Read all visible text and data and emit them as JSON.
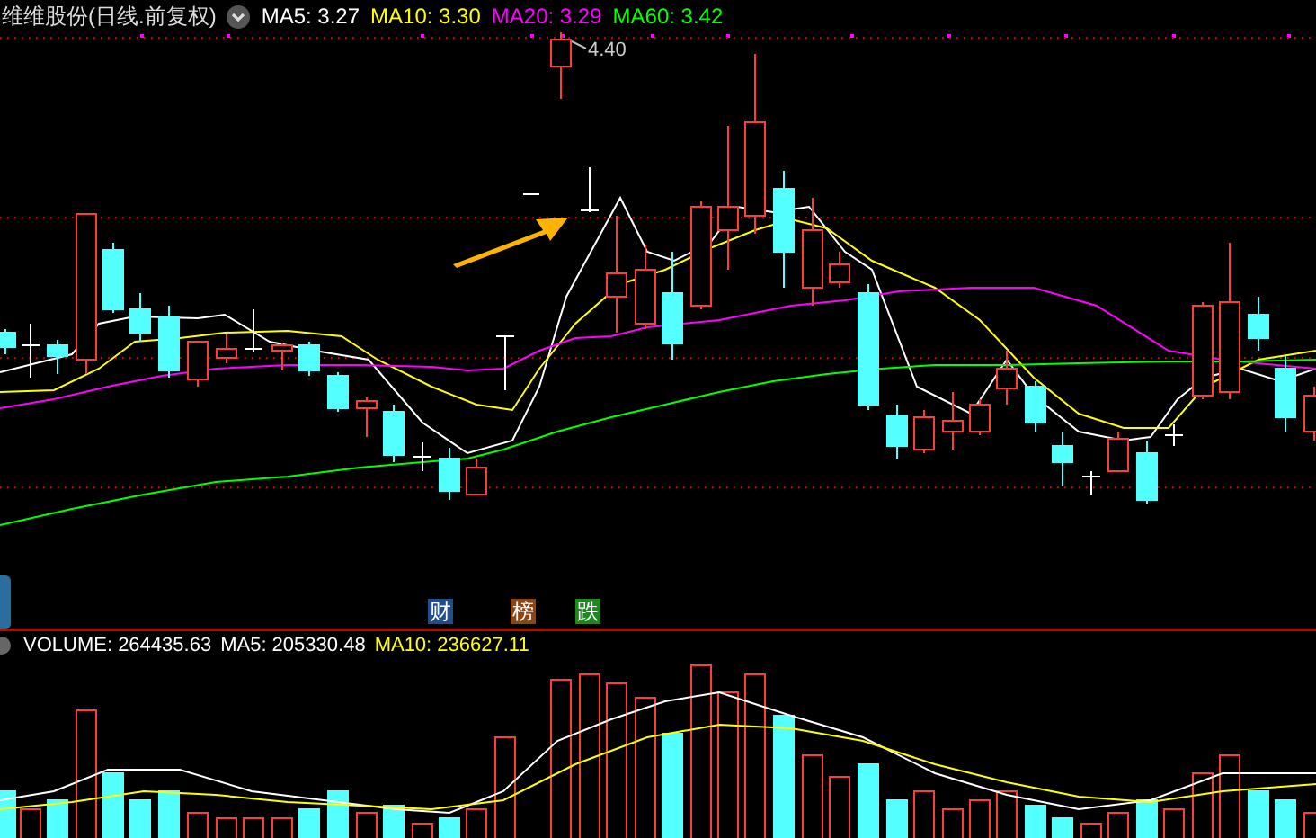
{
  "header": {
    "title": "维维股份(日线.前复权)",
    "indicators": [
      {
        "label": "MA5: 3.27",
        "color": "#ffffff"
      },
      {
        "label": "MA10: 3.30",
        "color": "#ffff00"
      },
      {
        "label": "MA20: 3.29",
        "color": "#ff00ff"
      },
      {
        "label": "MA60: 3.42",
        "color": "#00ff00"
      }
    ]
  },
  "price_label": "4.40",
  "event_tags": [
    {
      "label": "财",
      "color": "#1f4e8c"
    },
    {
      "label": "榜",
      "color": "#8b4513"
    },
    {
      "label": "跌",
      "color": "#1a8a1a"
    }
  ],
  "volume_header": {
    "indicators": [
      {
        "label": "VOLUME: 264435.63",
        "color": "#ffffff"
      },
      {
        "label": "MA5: 205330.48",
        "color": "#ffffff"
      },
      {
        "label": "MA10: 236627.11",
        "color": "#ffff00"
      }
    ]
  }
}
